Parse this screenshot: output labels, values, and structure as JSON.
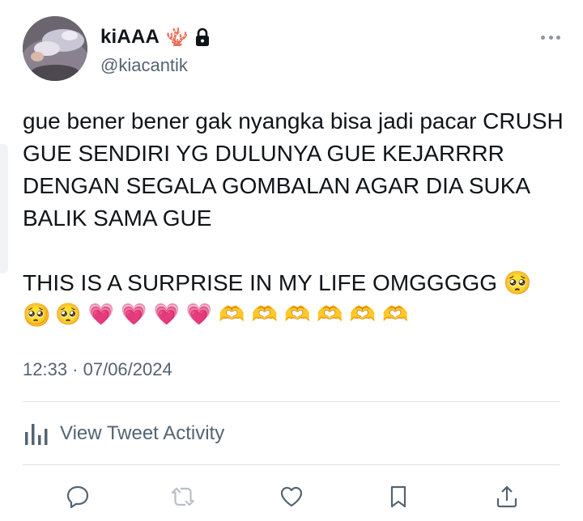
{
  "user": {
    "display_name": "kiAAA",
    "badge_emoji": "🪸",
    "handle": "@kiacantik",
    "protected": true
  },
  "tweet": {
    "text": "gue bener bener gak nyangka bisa jadi pacar CRUSH GUE SENDIRI YG DULUNYA GUE KEJARRRR DENGAN SEGALA GOMBALAN AGAR DIA SUKA BALIK SAMA GUE\n\nTHIS IS A SURPRISE IN MY LIFE OMGGGGG 🥺 🥺",
    "emoji_line": [
      "🥺",
      "🥺",
      "💗",
      "💗",
      "💗",
      "💗",
      "🫶",
      "🫶",
      "🫶",
      "🫶",
      "🫶",
      "🫶"
    ],
    "timestamp": "12:33 · 07/06/2024"
  },
  "activity": {
    "label": "View Tweet Activity"
  },
  "actions": [
    "reply-icon",
    "retweet-icon",
    "like-icon",
    "bookmark-icon",
    "share-icon"
  ],
  "colors": {
    "text": "#0f1419",
    "secondary": "#536471",
    "divider": "#dfe3e7",
    "icon": "#536471"
  }
}
